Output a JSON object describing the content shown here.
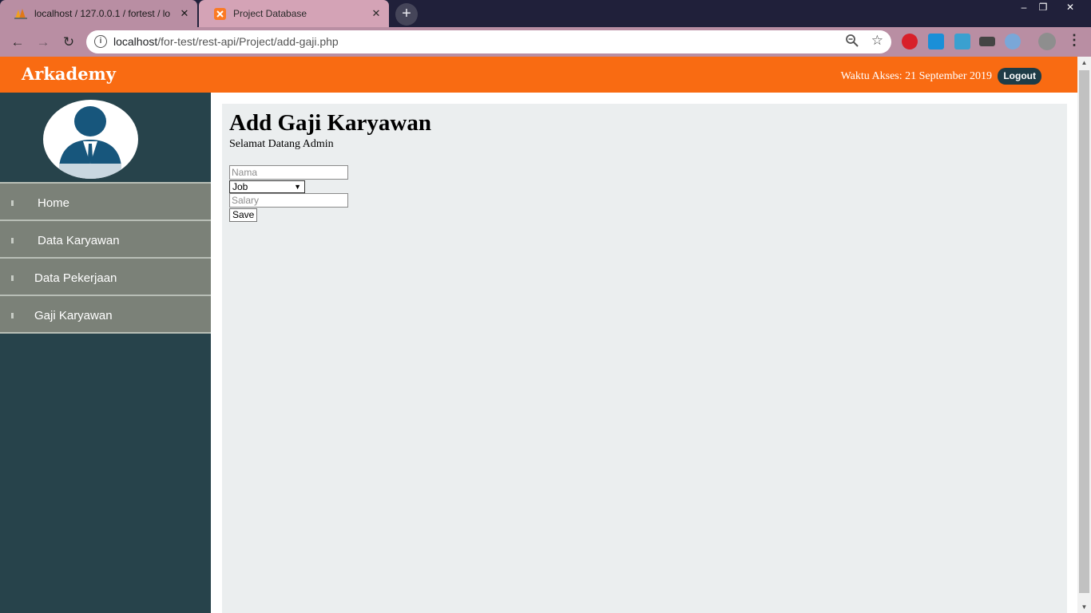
{
  "browser": {
    "tabs": [
      {
        "title": "localhost / 127.0.0.1 / fortest / lo",
        "close": "✕"
      },
      {
        "title": "Project Database",
        "close": "✕"
      }
    ],
    "new_tab": "+",
    "window_controls": {
      "minimize": "–",
      "restore": "❐",
      "close": "✕"
    },
    "url_host": "localhost",
    "url_path": "/for-test/rest-api/Project/add-gaji.php",
    "nav": {
      "back": "←",
      "forward": "→",
      "reload": "↻"
    },
    "info_symbol": "i",
    "star_symbol": "☆",
    "menu_symbol": "⋮"
  },
  "header": {
    "brand": "Arkademy",
    "access_time": "Waktu Akses: 21 September 2019",
    "logout_label": "Logout"
  },
  "sidebar": {
    "items": [
      {
        "label": "Home"
      },
      {
        "label": "Data Karyawan"
      },
      {
        "label": "Data Pekerjaan"
      },
      {
        "label": "Gaji Karyawan"
      }
    ]
  },
  "main": {
    "title": "Add Gaji Karyawan",
    "welcome": "Selamat Datang Admin",
    "form": {
      "nama_placeholder": "Nama",
      "job_selected": "Job",
      "salary_placeholder": "Salary",
      "save_label": "Save"
    }
  },
  "colors": {
    "header": "#f96b12",
    "sidebar": "#27434b",
    "menu_item": "#7b8178",
    "content_bg": "#ebeeef",
    "logout_bg": "#1e3c47"
  }
}
